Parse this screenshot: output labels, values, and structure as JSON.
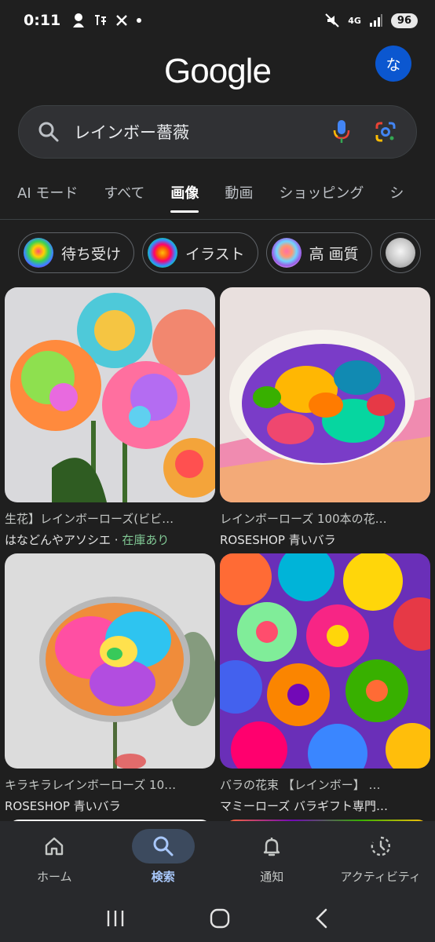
{
  "status": {
    "time": "0:11",
    "network": "4G",
    "battery": "96"
  },
  "header": {
    "logo": "Google",
    "avatar_letter": "な"
  },
  "search": {
    "query": "レインボー薔薇"
  },
  "tabs": [
    {
      "label": "AI モード"
    },
    {
      "label": "すべて"
    },
    {
      "label": "画像"
    },
    {
      "label": "動画"
    },
    {
      "label": "ショッピング"
    },
    {
      "label": "シ"
    }
  ],
  "chips": [
    {
      "label": "待ち受け"
    },
    {
      "label": "イラスト"
    },
    {
      "label": "高 画質"
    },
    {
      "label": ""
    }
  ],
  "results": [
    {
      "title": "生花】レインボーローズ(ビビ…",
      "source": "はなどんやアソシエ",
      "separator": " · ",
      "stock": "在庫あり"
    },
    {
      "title": "レインボーローズ 100本の花…",
      "source": "ROSESHOP 青いバラ"
    },
    {
      "title": "キラキラレインボーローズ 10…",
      "source": "ROSESHOP 青いバラ"
    },
    {
      "title": "バラの花束 【レインボー】 …",
      "source": "マミーローズ バラギフト専門…"
    }
  ],
  "bottom_nav": [
    {
      "label": "ホーム",
      "icon": "home-icon"
    },
    {
      "label": "検索",
      "icon": "search-icon"
    },
    {
      "label": "通知",
      "icon": "bell-icon"
    },
    {
      "label": "アクティビティ",
      "icon": "history-icon"
    }
  ]
}
